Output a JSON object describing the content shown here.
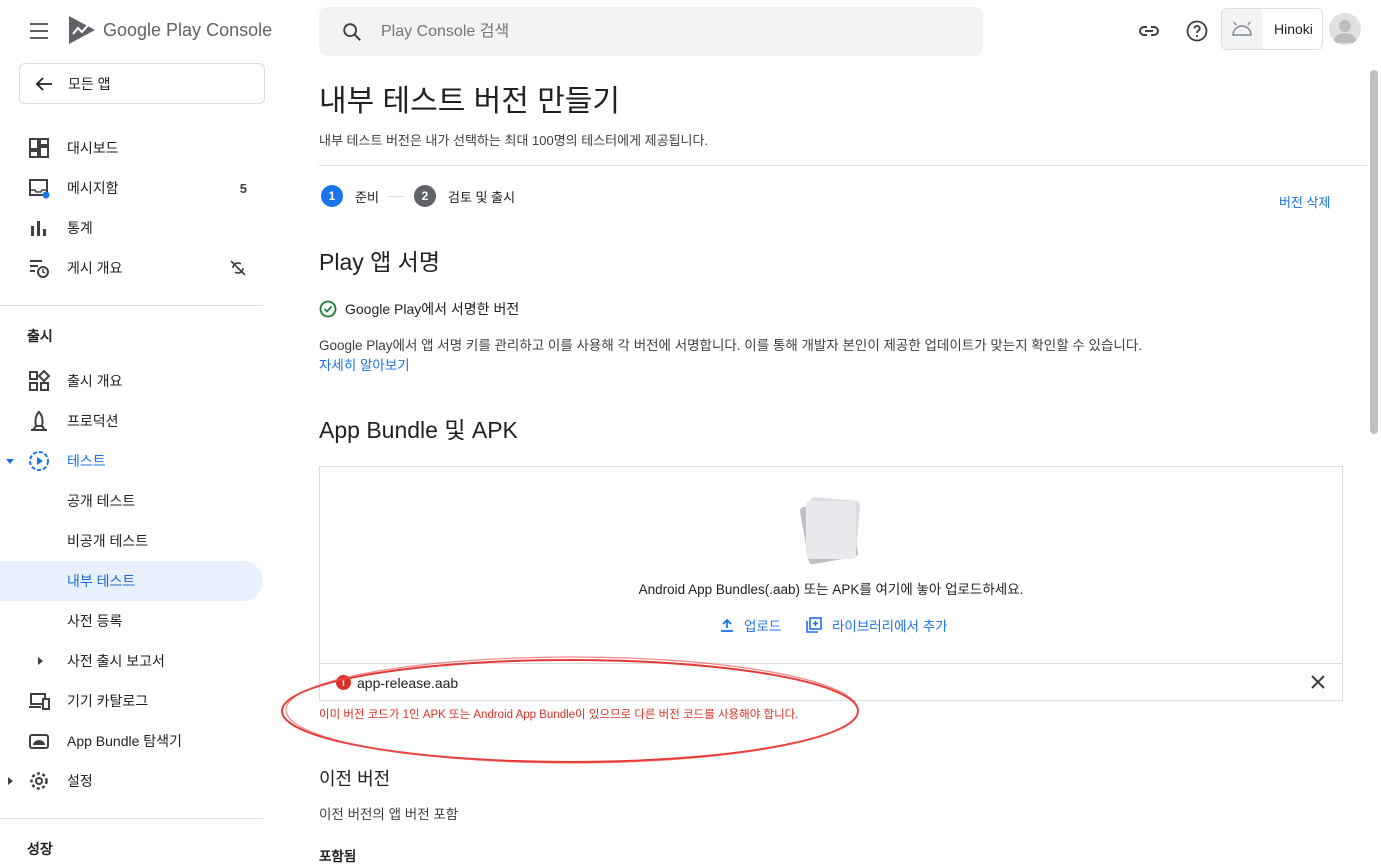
{
  "header": {
    "logo_name": "Google Play",
    "logo_sub": "Console",
    "search_placeholder": "Play Console 검색",
    "account_name": "Hinoki"
  },
  "sidebar": {
    "back_label": "모든 앱",
    "items_top": [
      {
        "label": "대시보드",
        "icon": "dashboard-icon"
      },
      {
        "label": "메시지함",
        "icon": "inbox-icon",
        "badge": "5"
      },
      {
        "label": "통계",
        "icon": "bar-chart-icon"
      },
      {
        "label": "게시 개요",
        "icon": "publishing-icon"
      }
    ],
    "section_release": "출시",
    "items_release": [
      {
        "label": "출시 개요",
        "icon": "release-overview-icon"
      },
      {
        "label": "프로덕션",
        "icon": "production-icon"
      },
      {
        "label": "테스트",
        "icon": "testing-icon"
      },
      {
        "label": "공개 테스트"
      },
      {
        "label": "비공개 테스트"
      },
      {
        "label": "내부 테스트"
      },
      {
        "label": "사전 등록"
      },
      {
        "label": "사전 출시 보고서"
      },
      {
        "label": "기기 카탈로그",
        "icon": "device-catalog-icon"
      },
      {
        "label": "App Bundle 탐색기",
        "icon": "android-icon"
      },
      {
        "label": "설정",
        "icon": "gear-icon"
      }
    ],
    "section_growth": "성장"
  },
  "main": {
    "title": "내부 테스트 버전 만들기",
    "description": "내부 테스트 버전은 내가 선택하는 최대 100명의 테스터에게 제공됩니다.",
    "steps": [
      {
        "num": "1",
        "label": "준비"
      },
      {
        "num": "2",
        "label": "검토 및 출시"
      }
    ],
    "delete_label": "버전 삭제",
    "signing": {
      "heading": "Play 앱 서명",
      "status": "Google Play에서 서명한 버전",
      "body": "Google Play에서 앱 서명 키를 관리하고 이를 사용해 각 버전에 서명합니다. 이를 통해 개발자 본인이 제공한 업데이트가 맞는지 확인할 수 있습니다.",
      "learn_more": "자세히 알아보기"
    },
    "bundles": {
      "heading": "App Bundle 및 APK",
      "drop_text": "Android App Bundles(.aab) 또는 APK를 여기에 놓아 업로드하세요.",
      "upload_label": "업로드",
      "library_label": "라이브러리에서 추가",
      "file_name": "app-release.aab",
      "error": "이미 버전 코드가 1인 APK 또는 Android App Bundle이 있으므로 다른 버전 코드를 사용해야 합니다."
    },
    "previous": {
      "heading": "이전 버전",
      "body": "이전 버전의 앱 버전 포함",
      "included": "포함됨"
    }
  },
  "colors": {
    "accent": "#1a73e8",
    "error": "#d93025",
    "success": "#188038",
    "selected_bg": "#e8f0fe"
  }
}
